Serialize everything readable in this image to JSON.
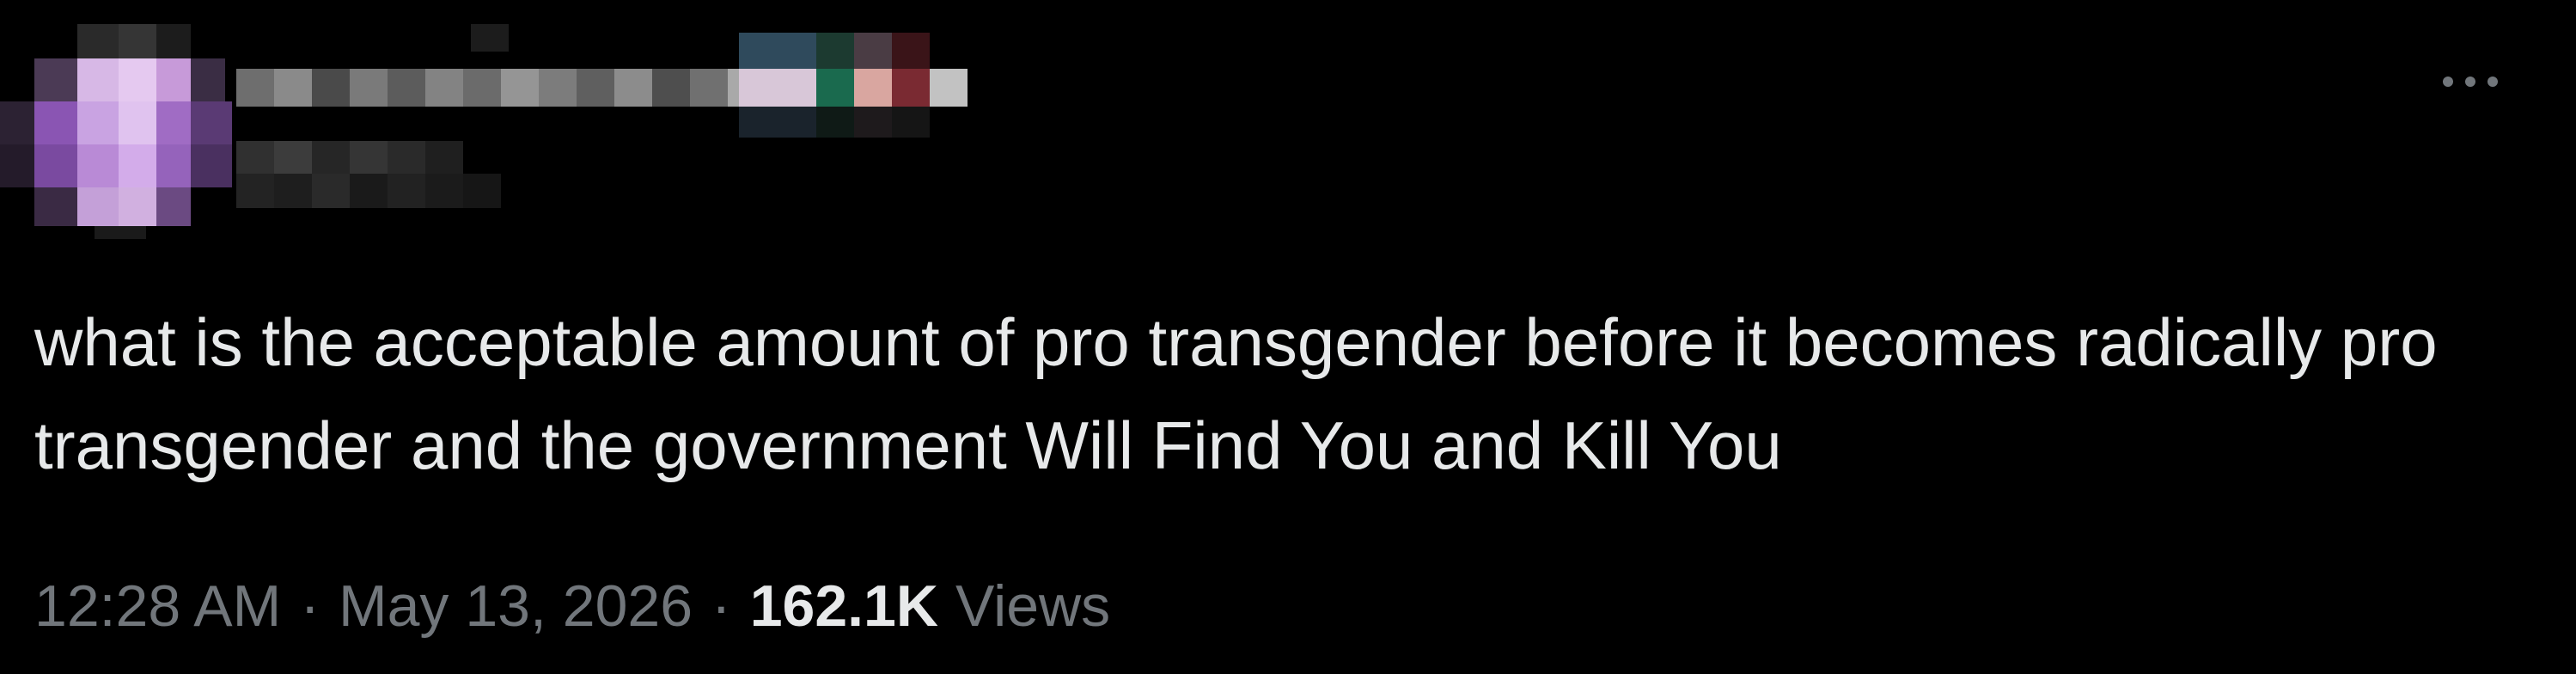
{
  "tweet": {
    "text": "what is the acceptable amount of pro transgender before it becomes radically pro transgender and the government Will Find You and Kill You",
    "time": "12:28 AM",
    "separator": "·",
    "date": "May 13, 2026",
    "views_count": "162.1K",
    "views_label": "Views",
    "more_icon": "more-horizontal-icon"
  },
  "colors": {
    "background": "#000000",
    "primary_text": "#e7e9ea",
    "secondary_text": "#71767b"
  }
}
